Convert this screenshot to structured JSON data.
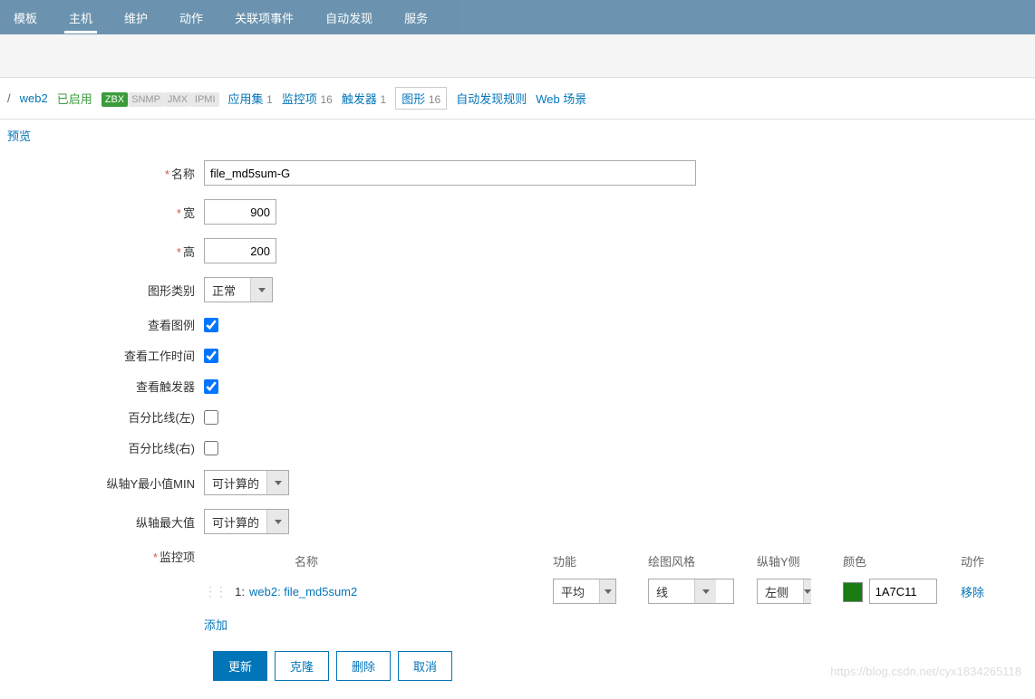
{
  "nav": {
    "items": [
      "模板",
      "主机",
      "维护",
      "动作",
      "关联项事件",
      "自动发现",
      "服务"
    ],
    "active_index": 1
  },
  "breadcrumb": {
    "host": "web2",
    "status": "已启用",
    "zbx": "ZBX",
    "snmp": "SNMP",
    "jmx": "JMX",
    "ipmi": "IPMI",
    "app_set": "应用集",
    "app_set_count": "1",
    "items": "监控项",
    "items_count": "16",
    "triggers": "触发器",
    "triggers_count": "1",
    "graphs": "图形",
    "graphs_count": "16",
    "discovery": "自动发现规则",
    "web_scenario": "Web 场景"
  },
  "preview": "预览",
  "form": {
    "name_label": "名称",
    "name_value": "file_md5sum-G",
    "width_label": "宽",
    "width_value": "900",
    "height_label": "高",
    "height_value": "200",
    "graph_type_label": "图形类别",
    "graph_type_value": "正常",
    "show_legend_label": "查看图例",
    "show_worktime_label": "查看工作时间",
    "show_triggers_label": "查看触发器",
    "percent_left_label": "百分比线(左)",
    "percent_right_label": "百分比线(右)",
    "ymin_label": "纵轴Y最小值MIN",
    "ymin_value": "可计算的",
    "ymax_label": "纵轴最大值",
    "ymax_value": "可计算的",
    "items_label": "监控项"
  },
  "items_table": {
    "headers": {
      "name": "名称",
      "func": "功能",
      "style": "绘图风格",
      "side": "纵轴Y侧",
      "color": "颜色",
      "action": "动作"
    },
    "rows": [
      {
        "index": "1:",
        "name": "web2: file_md5sum2",
        "func": "平均",
        "style": "线",
        "side": "左侧",
        "color": "1A7C11",
        "color_hex": "#1A7C11",
        "remove": "移除"
      }
    ],
    "add": "添加"
  },
  "buttons": {
    "update": "更新",
    "clone": "克隆",
    "delete": "删除",
    "cancel": "取消"
  },
  "watermark": "https://blog.csdn.net/cyx1834265118"
}
